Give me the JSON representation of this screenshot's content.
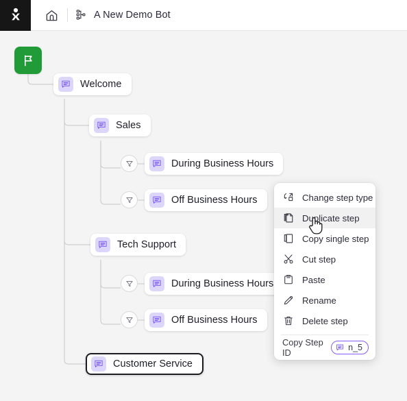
{
  "header": {
    "logo_icon": "brand-logo-icon",
    "home_icon": "home-icon",
    "flow_icon": "flow-tree-icon",
    "title": "A New Demo Bot"
  },
  "canvas": {
    "start_node": {
      "icon": "flag-icon",
      "color": "#219b38"
    },
    "nodes": [
      {
        "id": "welcome",
        "label": "Welcome",
        "icon": "message-icon",
        "selected": false
      },
      {
        "id": "sales",
        "label": "Sales",
        "icon": "message-icon",
        "selected": false
      },
      {
        "id": "sales-during",
        "label": "During Business Hours",
        "icon": "message-icon",
        "selected": false
      },
      {
        "id": "sales-off",
        "label": "Off Business Hours",
        "icon": "message-icon",
        "selected": false
      },
      {
        "id": "tech",
        "label": "Tech Support",
        "icon": "message-icon",
        "selected": false
      },
      {
        "id": "tech-during",
        "label": "During Business Hours",
        "icon": "message-icon",
        "selected": false
      },
      {
        "id": "tech-off",
        "label": "Off Business Hours",
        "icon": "message-icon",
        "selected": false
      },
      {
        "id": "customer",
        "label": "Customer Service",
        "icon": "message-icon",
        "selected": true
      }
    ],
    "filters": [
      {
        "id": "filter-sales-during",
        "icon": "filter-icon"
      },
      {
        "id": "filter-sales-off",
        "icon": "filter-icon"
      },
      {
        "id": "filter-tech-during",
        "icon": "filter-icon"
      },
      {
        "id": "filter-tech-off",
        "icon": "filter-icon"
      }
    ],
    "node_badge_color": "#ddd6fb",
    "node_icon_color": "#7c5cf0"
  },
  "context_menu": {
    "items": [
      {
        "label": "Change step type",
        "icon": "change-step-type-icon",
        "hover": false
      },
      {
        "label": "Duplicate step",
        "icon": "duplicate-icon",
        "hover": true
      },
      {
        "label": "Copy single step",
        "icon": "copy-icon",
        "hover": false
      },
      {
        "label": "Cut step",
        "icon": "scissors-icon",
        "hover": false
      },
      {
        "label": "Paste",
        "icon": "clipboard-icon",
        "hover": false
      },
      {
        "label": "Rename",
        "icon": "pencil-icon",
        "hover": false
      },
      {
        "label": "Delete step",
        "icon": "trash-icon",
        "hover": false
      }
    ],
    "footer": {
      "label": "Copy Step ID",
      "chip_icon": "message-icon",
      "chip_value": "n_5",
      "chip_border_color": "#8b5cf6"
    }
  },
  "cursor": {
    "icon": "pointing-hand-cursor"
  }
}
